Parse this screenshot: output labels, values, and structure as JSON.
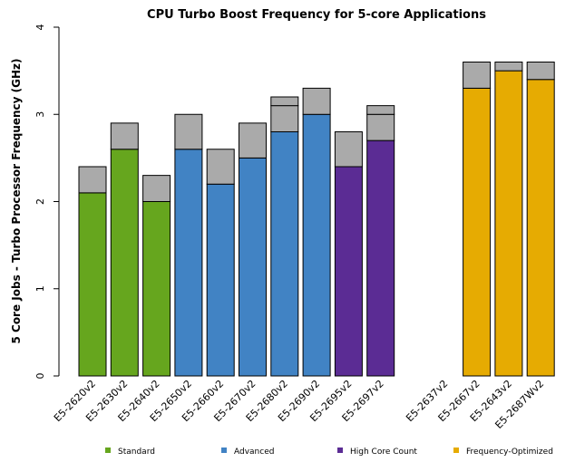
{
  "chart_data": {
    "type": "bar",
    "stacked": true,
    "title": "CPU Turbo Boost Frequency for 5-core Applications",
    "xlabel": "",
    "ylabel": "5 Core Jobs - Turbo Processor Frequency (GHz)",
    "ylim": [
      0,
      4
    ],
    "yticks": [
      "0",
      "1",
      "2",
      "3",
      "4"
    ],
    "grid": false,
    "turbo_color": "#aaaaaa",
    "categories": [
      "E5-2620v2",
      "E5-2630v2",
      "E5-2640v2",
      "E5-2650v2",
      "E5-2660v2",
      "E5-2670v2",
      "E5-2680v2",
      "E5-2690v2",
      "E5-2695v2",
      "E5-2697v2",
      "",
      "E5-2637v2",
      "E5-2667v2",
      "E5-2643v2",
      "E5-2687Wv2"
    ],
    "bars": [
      {
        "group": "Standard",
        "base": 2.1,
        "turbo_levels": [
          2.4
        ]
      },
      {
        "group": "Standard",
        "base": 2.6,
        "turbo_levels": [
          2.9
        ]
      },
      {
        "group": "Standard",
        "base": 2.0,
        "turbo_levels": [
          2.3
        ]
      },
      {
        "group": "Advanced",
        "base": 2.6,
        "turbo_levels": [
          3.0
        ]
      },
      {
        "group": "Advanced",
        "base": 2.2,
        "turbo_levels": [
          2.6
        ]
      },
      {
        "group": "Advanced",
        "base": 2.5,
        "turbo_levels": [
          2.9
        ]
      },
      {
        "group": "Advanced",
        "base": 2.8,
        "turbo_levels": [
          3.1,
          3.2
        ]
      },
      {
        "group": "Advanced",
        "base": 3.0,
        "turbo_levels": [
          3.3
        ]
      },
      {
        "group": "High Core Count",
        "base": 2.4,
        "turbo_levels": [
          2.8
        ]
      },
      {
        "group": "High Core Count",
        "base": 2.7,
        "turbo_levels": [
          3.0,
          3.1
        ]
      },
      null,
      null,
      {
        "group": "Frequency-Optimized",
        "base": 3.3,
        "turbo_levels": [
          3.6
        ]
      },
      {
        "group": "Frequency-Optimized",
        "base": 3.5,
        "turbo_levels": [
          3.6
        ]
      },
      {
        "group": "Frequency-Optimized",
        "base": 3.4,
        "turbo_levels": [
          3.6
        ]
      }
    ],
    "legend_placement": "bottom",
    "legend": [
      {
        "name": "Standard",
        "color": "#66a61e"
      },
      {
        "name": "Advanced",
        "color": "#4183c4"
      },
      {
        "name": "High Core Count",
        "color": "#5b2c94"
      },
      {
        "name": "Frequency-Optimized",
        "color": "#e6ab02"
      }
    ]
  }
}
